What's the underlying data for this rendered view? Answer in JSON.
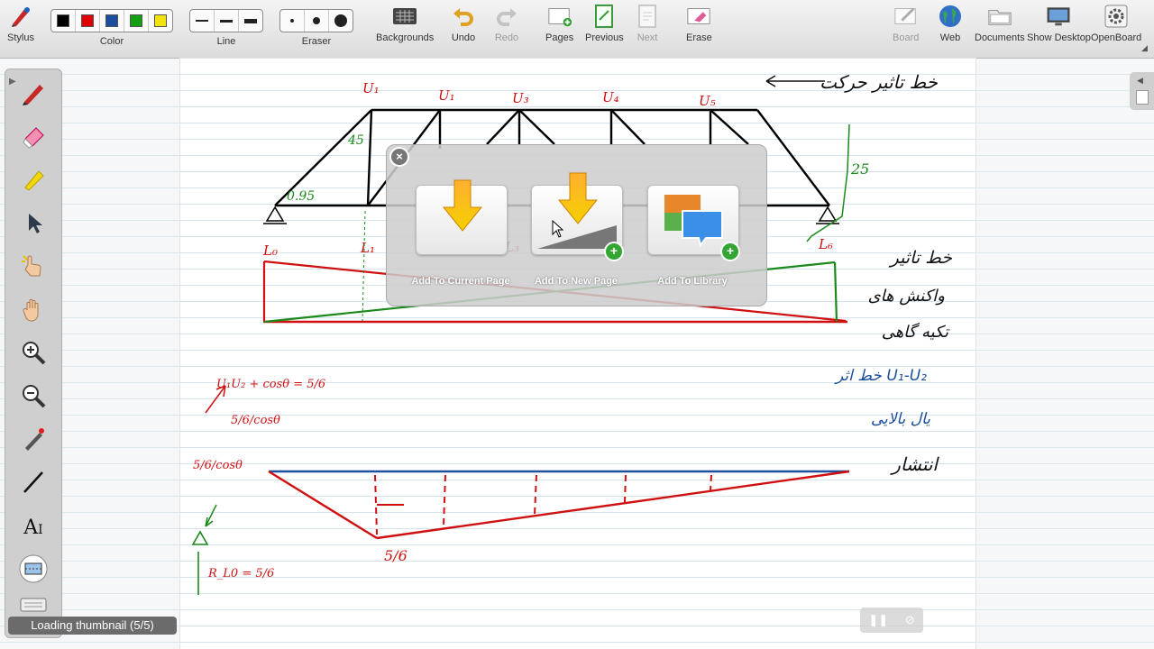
{
  "toolbar": {
    "stylus": "Stylus",
    "color": "Color",
    "line": "Line",
    "eraser": "Eraser",
    "backgrounds": "Backgrounds",
    "undo": "Undo",
    "redo": "Redo",
    "pages": "Pages",
    "previous": "Previous",
    "next": "Next",
    "erase": "Erase",
    "board": "Board",
    "web": "Web",
    "documents": "Documents",
    "show_desktop": "Show Desktop",
    "openboard": "OpenBoard",
    "colors": [
      "#000000",
      "#e00000",
      "#1a4fa0",
      "#12a012",
      "#f2e40a"
    ]
  },
  "import_dialog": {
    "add_current": "Add To Current Page",
    "add_new": "Add To New Page",
    "add_library": "Add To Library"
  },
  "drawing": {
    "node_labels": [
      "U₁",
      "U₁",
      "U₃",
      "U₄",
      "U₅",
      "L₀",
      "L₁",
      "L₃",
      "L₆"
    ],
    "dim_45": "45",
    "dim_25": "25",
    "dim_095": "0.95",
    "formula_1": "U₁U₂ + cosθ = 5/6",
    "formula_2": "5/6/cosθ",
    "formula_3": "5/6/cosθ",
    "value_5_6": "5/6",
    "reaction": "R_L0 = 5/6",
    "note_1": "خط تاثیر حرکت",
    "note_2": "خط تاثیر",
    "note_3": "واکنش های",
    "note_4": "تکیه گاهی",
    "note_5": "خط اثر U₁-U₂",
    "note_6": "یال بالایی",
    "note_7": "انتشار"
  },
  "status": {
    "loading": "Loading thumbnail (5/5)"
  }
}
